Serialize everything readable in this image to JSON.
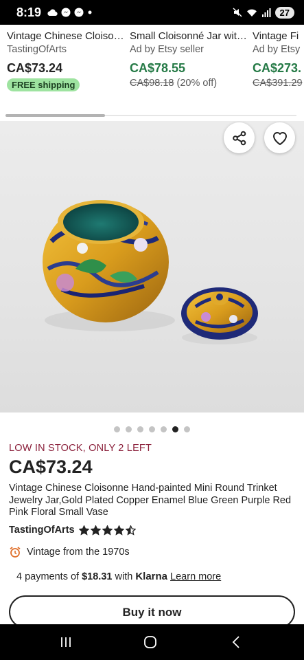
{
  "status_bar": {
    "time": "8:19",
    "battery": "27",
    "left_icons": [
      "cloud-icon",
      "messenger-icon",
      "messenger-icon",
      "dot-icon"
    ],
    "right_icons": [
      "mute-icon",
      "wifi-icon",
      "signal-icon",
      "battery-icon"
    ]
  },
  "recommendations": [
    {
      "title": "Vintage Chinese Cloiso…",
      "subtitle": "TastingOfArts",
      "price": "CA$73.24",
      "badge": "FREE shipping",
      "on_sale": false
    },
    {
      "title": "Small Cloisonné Jar wit…",
      "subtitle": "Ad by Etsy seller",
      "price": "CA$78.55",
      "original_price": "CA$98.18",
      "discount": "(20% off)",
      "on_sale": true
    },
    {
      "title": "Vintage Fi",
      "subtitle": "Ad by Etsy",
      "price": "CA$273.",
      "original_price": "CA$391.29",
      "on_sale": true
    }
  ],
  "image_gallery": {
    "share_icon": "share-icon",
    "favorite_icon": "heart-icon",
    "total_images": 7,
    "active_index": 5
  },
  "listing": {
    "stock_notice": "LOW IN STOCK, ONLY 2 LEFT",
    "price": "CA$73.24",
    "title": "Vintage Chinese Cloisonne Hand-painted Mini Round Trinket Jewelry Jar,Gold Plated Copper Enamel Blue Green Purple Red Pink Floral Small Vase",
    "shop_name": "TastingOfArts",
    "rating": 4.5,
    "vintage_text": "Vintage from the 1970s"
  },
  "payments": {
    "prefix": "4 payments of",
    "amount": "$18.31",
    "with": "with",
    "provider": "Klarna",
    "learn_more": "Learn more"
  },
  "buy_button": {
    "label": "Buy it now"
  },
  "nav_bar": {
    "icons": [
      "recents-icon",
      "home-icon",
      "back-icon"
    ]
  },
  "colors": {
    "sale_green": "#257a46",
    "stock_red": "#8a1f3a",
    "free_badge": "#9ee3a0",
    "text": "#222222",
    "muted": "#595959"
  }
}
